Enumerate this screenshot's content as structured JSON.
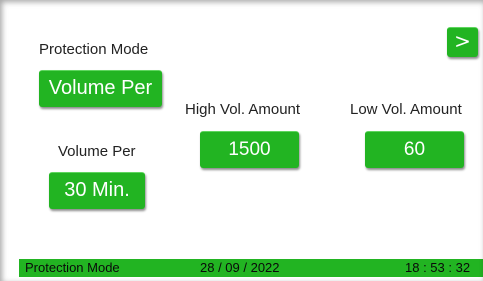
{
  "nav": {
    "next_label": ">"
  },
  "protection": {
    "title": "Protection Mode",
    "mode_value": "Volume Per"
  },
  "interval": {
    "title": "Volume Per",
    "value": "30 Min."
  },
  "high_vol": {
    "title": "High Vol. Amount",
    "value": "1500"
  },
  "low_vol": {
    "title": "Low Vol. Amount",
    "value": "60"
  },
  "status": {
    "mode": "Protection Mode",
    "date": "28 / 09 / 2022",
    "time": "18 : 53 : 32"
  },
  "colors": {
    "accent_green": "#22b422",
    "text": "#222222",
    "background": "#ffffff"
  }
}
